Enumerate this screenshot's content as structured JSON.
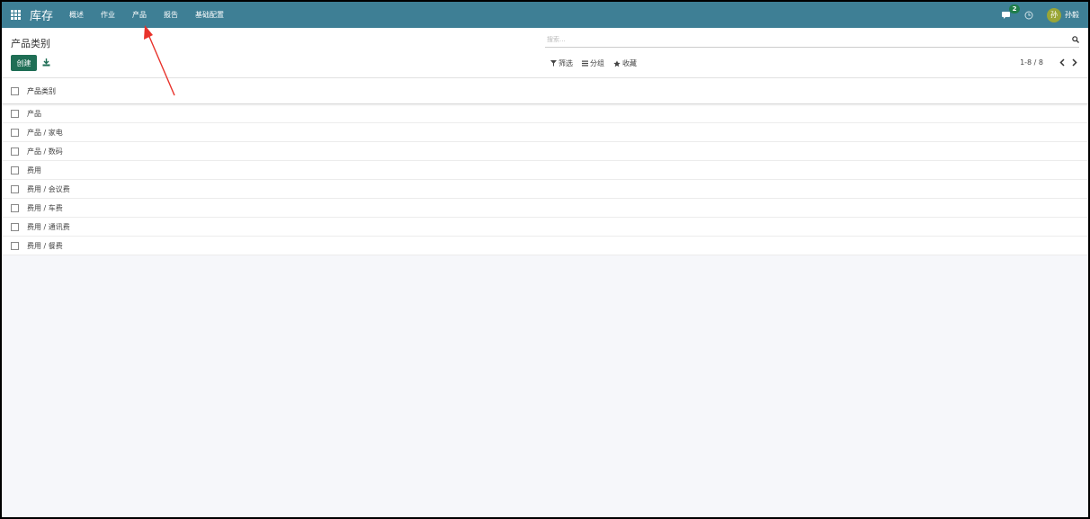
{
  "navbar": {
    "app_title": "库存",
    "menu": [
      "概述",
      "作业",
      "产品",
      "报告",
      "基础配置"
    ],
    "chat_count": "2",
    "user": {
      "avatar_letter": "孙",
      "name": "孙毅"
    }
  },
  "control_panel": {
    "breadcrumb": "产品类别",
    "create_label": "创建",
    "search_placeholder": "搜索...",
    "filters": [
      {
        "label": "筛选",
        "icon": "filter-icon"
      },
      {
        "label": "分组",
        "icon": "list-icon"
      },
      {
        "label": "收藏",
        "icon": "star-icon"
      }
    ],
    "pager": "1-8 / 8"
  },
  "list": {
    "column_header": "产品类别",
    "rows": [
      "产品",
      "产品 / 家电",
      "产品 / 数码",
      "费用",
      "费用 / 会议费",
      "费用 / 车费",
      "费用 / 通讯费",
      "费用 / 餐费"
    ]
  },
  "colors": {
    "navbar": "#3e7f95",
    "primary_button": "#1f6e55",
    "annotation_arrow": "#e8322b"
  }
}
